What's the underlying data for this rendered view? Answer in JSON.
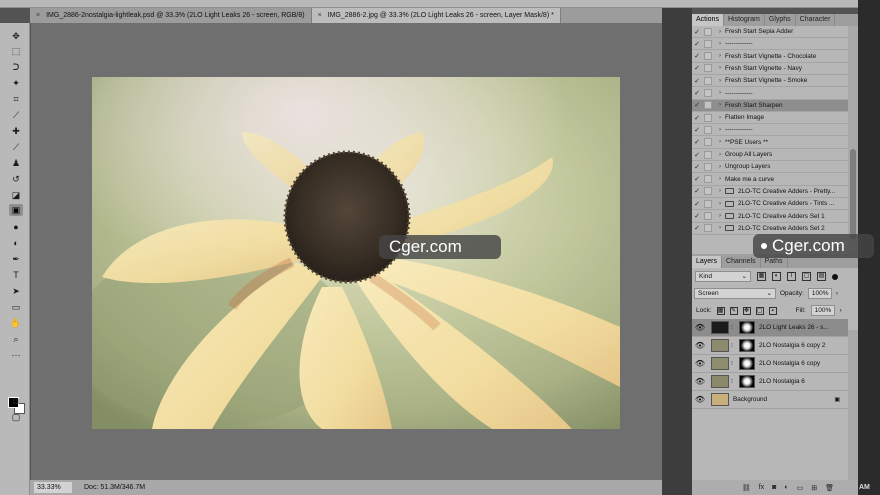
{
  "doc_tabs": [
    {
      "label": "IMG_2886-2nostalgia-lightleak.psd @ 33.3% (2LO Light Leaks 26 - screen, RGB/8)",
      "close": "×",
      "active": false
    },
    {
      "label": "IMG_2886-2.jpg @ 33.3% (2LO Light Leaks 26 - screen, Layer Mask/8) *",
      "close": "×",
      "active": true
    }
  ],
  "panel_tabs_top": [
    "Actions",
    "Histogram",
    "Glyphs",
    "Character"
  ],
  "actions": [
    {
      "label": "Fresh Start Sepia Adder",
      "checked": true
    },
    {
      "label": "-------------",
      "checked": true
    },
    {
      "label": "Fresh Start Vignette - Chocolate",
      "checked": true
    },
    {
      "label": "Fresh Start Vignette - Navy",
      "checked": true
    },
    {
      "label": "Fresh Start Vignette - Smoke",
      "checked": true
    },
    {
      "label": "-------------",
      "checked": true
    },
    {
      "label": "Fresh Start Sharpen",
      "checked": true,
      "highlight": true
    },
    {
      "label": "Flatten Image",
      "checked": true
    },
    {
      "label": "-------------",
      "checked": true
    },
    {
      "label": "**PSE Users **",
      "checked": true
    },
    {
      "label": "Group All Layers",
      "checked": true
    },
    {
      "label": "Ungroup Layers",
      "checked": true
    },
    {
      "label": "Make me a curve",
      "checked": true
    },
    {
      "label": "2LO-TC Creative Adders - Pretty...",
      "checked": true,
      "folder": true
    },
    {
      "label": "2LO-TC Creative Adders - Tints ...",
      "checked": true,
      "folder": true
    },
    {
      "label": "2LO-TC Creative Adders Set 1",
      "checked": true,
      "folder": true
    },
    {
      "label": "2LO-TC Creative Adders Set 2",
      "checked": true,
      "folder": true
    }
  ],
  "panel_tabs_layers": [
    "Layers",
    "Channels",
    "Paths"
  ],
  "layers_controls": {
    "filter_kind": "Kind",
    "blend_mode": "Screen",
    "opacity_label": "Opacity:",
    "opacity_value": "100%",
    "lock_label": "Lock:",
    "fill_label": "Fill:",
    "fill_value": "100%"
  },
  "layers": [
    {
      "name": "2LO Light Leaks 26 - s...",
      "selected": true,
      "has_mask": true
    },
    {
      "name": "2LO Nostalgia 6 copy 2",
      "selected": false,
      "has_mask": true
    },
    {
      "name": "2LO Nostalgia 6 copy",
      "selected": false,
      "has_mask": true
    },
    {
      "name": "2LO Nostalgia 6",
      "selected": false,
      "has_mask": true
    },
    {
      "name": "Background",
      "selected": false,
      "has_mask": false,
      "locked": true
    }
  ],
  "status": {
    "zoom": "33.33%",
    "doc_size": "Doc: 51.3M/346.7M"
  },
  "watermarks": [
    "Cger.com",
    "Cger.com"
  ],
  "clock_fragment": "AM",
  "icons": {
    "eye": "👁",
    "check": "✓",
    "caret": "›",
    "lock": "🔒"
  },
  "colors": {
    "foreground": "#000000",
    "background": "#ffffff",
    "panel": "#b7b7b7",
    "canvas": "#6f6f6f"
  }
}
